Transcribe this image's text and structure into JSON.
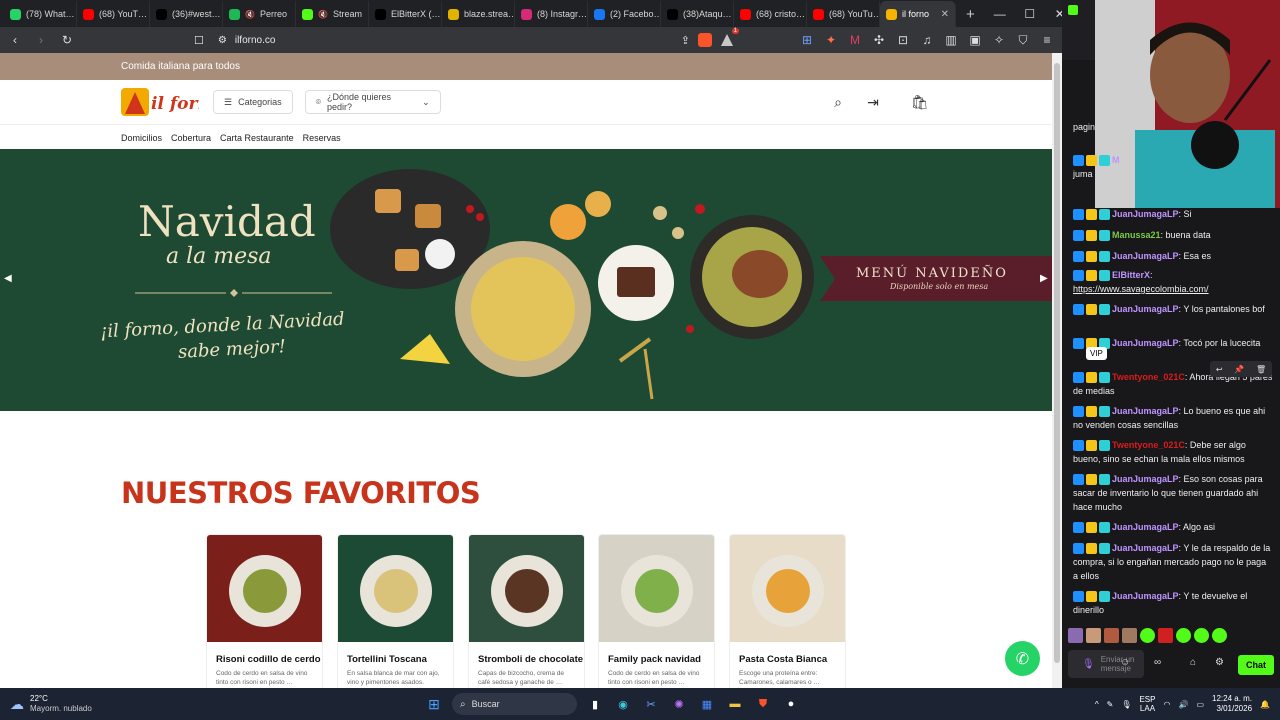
{
  "tabs": [
    {
      "label": "(78) What…",
      "color": "#25d366",
      "icon": "whatsapp-icon"
    },
    {
      "label": "(68) YouT…",
      "color": "#ff0000",
      "icon": "youtube-icon"
    },
    {
      "label": "(36)#west…",
      "color": "#000000",
      "icon": "tiktok-icon"
    },
    {
      "label": "Perreo",
      "color": "#1db954",
      "icon": "spotify-icon",
      "muted": true
    },
    {
      "label": "Stream",
      "color": "#53fc18",
      "icon": "kick-icon",
      "muted": true
    },
    {
      "label": "ElBitterX (…",
      "color": "#000000",
      "icon": "tiktok-icon"
    },
    {
      "label": "blaze.strea…",
      "color": "#e0b300",
      "icon": "blaze-icon"
    },
    {
      "label": "(8) Instagr…",
      "color": "#d62976",
      "icon": "instagram-icon"
    },
    {
      "label": "(2) Facebo…",
      "color": "#1877f2",
      "icon": "facebook-icon"
    },
    {
      "label": "(38)Ataqu…",
      "color": "#000000",
      "icon": "tiktok-icon"
    },
    {
      "label": "(68) cristo…",
      "color": "#ff0000",
      "icon": "youtube-icon"
    },
    {
      "label": "(68) YouTu…",
      "color": "#ff0000",
      "icon": "youtube-icon"
    },
    {
      "label": "il forno",
      "color": "#f5b400",
      "icon": "ilforno-favicon",
      "active": true
    }
  ],
  "browser": {
    "url": "ilforno.co",
    "new_tab": "+",
    "min": "—",
    "max": "☐",
    "close": "✕",
    "shield_count": "1"
  },
  "site": {
    "tagline": "Comida italiana para todos",
    "logo_text": "il forno",
    "categories_label": "Categorias",
    "location_placeholder": "¿Dónde quieres pedir?",
    "nav": [
      "Domicilios",
      "Cobertura",
      "Carta Restaurante",
      "Reservas"
    ],
    "hero": {
      "title_line1": "Navidad",
      "title_line2": "a la mesa",
      "subtitle_line1": "¡il forno, donde la Navidad",
      "subtitle_line2": "sabe mejor!",
      "badge_title": "MENÚ NAVIDEÑO",
      "badge_sub": "Disponible solo en mesa"
    },
    "favorites_title": "NUESTROS FAVORITOS",
    "products": [
      {
        "name": "Risoni codillo de cerdo",
        "desc": "Codo de cerdo en salsa de vino tinto con risoni en pesto …",
        "bg": "#7a1f1a",
        "fg": "#8a9a3a"
      },
      {
        "name": "Tortellini Toscana",
        "desc": "En salsa blanca de mar con ajo, vino y pimentones asados.",
        "bg": "#1d4a35",
        "fg": "#d9c27a"
      },
      {
        "name": "Stromboli de chocolate",
        "desc": "Capas de bizcocho, crema de café sedosa y ganache de …",
        "bg": "#2e4f3d",
        "fg": "#5a3524"
      },
      {
        "name": "Family pack navidad",
        "desc": "Codo de cerdo en salsa de vino tinto con risoni en pesto …",
        "bg": "#d6d2c6",
        "fg": "#7fb04a"
      },
      {
        "name": "Pasta Costa Bianca",
        "desc": "Escoge una proteína entre: Camarones, calamares o …",
        "bg": "#e7dcc7",
        "fg": "#e8a23a"
      }
    ]
  },
  "chat": {
    "messages": [
      {
        "user": "",
        "text": "pagin",
        "color": "#efeff1"
      },
      {
        "user": "M",
        "text": "",
        "color": "#bf94ff"
      },
      {
        "user": "",
        "text": "juma",
        "color": "#efeff1"
      },
      {
        "user": "JuanJumagaLP",
        "text": ": Si",
        "color": "#bf94ff"
      },
      {
        "user": "Manussa21",
        "text": ": buena data",
        "color": "#7ec843"
      },
      {
        "user": "JuanJumagaLP",
        "text": ": Esa es",
        "color": "#bf94ff"
      },
      {
        "user": "ElBitterX",
        "text": ":",
        "color": "#bf94ff"
      },
      {
        "user": "",
        "text": "https://www.savagecolombia.com/",
        "color": "#efeff1"
      },
      {
        "user": "JuanJumagaLP",
        "text": ": Y los pantalones bof",
        "color": "#bf94ff"
      },
      {
        "user": "JuanJumagaLP",
        "text": ": Tocó por la lucecita",
        "color": "#bf94ff"
      },
      {
        "user": "Twentyone_021C",
        "text": ": Ahora llegan 5 pares de medias",
        "color": "#d91c1c"
      },
      {
        "user": "JuanJumagaLP",
        "text": ": Lo bueno es que ahi no venden cosas sencillas",
        "color": "#bf94ff"
      },
      {
        "user": "Twentyone_021C",
        "text": ": Debe ser algo bueno, sino se echan la mala ellos mismos",
        "color": "#d91c1c"
      },
      {
        "user": "JuanJumagaLP",
        "text": ": Eso son cosas para sacar de inventario lo que tienen guardado ahi hace mucho",
        "color": "#bf94ff"
      },
      {
        "user": "JuanJumagaLP",
        "text": ": Algo asi",
        "color": "#bf94ff"
      },
      {
        "user": "JuanJumagaLP",
        "text": ": Y le da respaldo de la compra, si lo engañan mercado pago no le paga a ellos",
        "color": "#bf94ff"
      },
      {
        "user": "JuanJumagaLP",
        "text": ": Y te devuelve el dinerillo",
        "color": "#bf94ff"
      }
    ],
    "vip_tooltip": "VIP",
    "input_placeholder": "Enviar un mensaje",
    "chat_button": "Chat"
  },
  "taskbar": {
    "weather_temp": "22°C",
    "weather_desc": "Mayorm. nublado",
    "search_placeholder": "Buscar",
    "lang1": "ESP",
    "lang2": "LAA",
    "time": "12:24 a. m.",
    "date": "3/01/2026"
  }
}
